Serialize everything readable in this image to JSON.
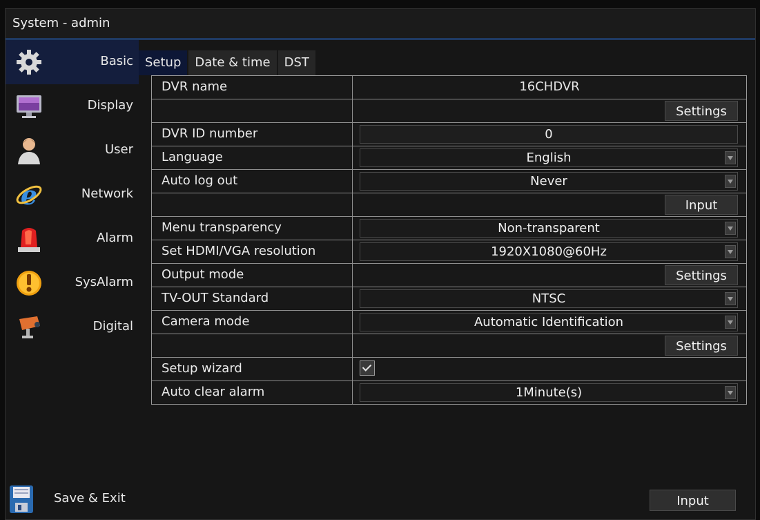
{
  "window": {
    "title": "System - admin"
  },
  "sidebar": {
    "items": [
      {
        "label": "Basic",
        "icon": "gear-icon",
        "active": true
      },
      {
        "label": "Display",
        "icon": "monitor-icon"
      },
      {
        "label": "User",
        "icon": "user-icon"
      },
      {
        "label": "Network",
        "icon": "network-icon"
      },
      {
        "label": "Alarm",
        "icon": "alarm-light-icon"
      },
      {
        "label": "SysAlarm",
        "icon": "warning-icon"
      },
      {
        "label": "Digital",
        "icon": "camera-icon"
      }
    ],
    "save_exit": {
      "label": "Save & Exit",
      "icon": "floppy-disk-icon"
    }
  },
  "tabs": [
    {
      "label": "Setup",
      "active": true
    },
    {
      "label": "Date & time"
    },
    {
      "label": "DST"
    }
  ],
  "settings": {
    "dvr_name": {
      "label": "DVR name",
      "value": "16CHDVR"
    },
    "dvr_name_settings": {
      "button": "Settings"
    },
    "dvr_id": {
      "label": "DVR ID number",
      "value": "0"
    },
    "language": {
      "label": "Language",
      "value": "English"
    },
    "auto_logout": {
      "label": "Auto log out",
      "value": "Never"
    },
    "auto_logout_input": {
      "button": "Input"
    },
    "menu_transparency": {
      "label": "Menu transparency",
      "value": "Non-transparent"
    },
    "resolution": {
      "label": "Set HDMI/VGA resolution",
      "value": "1920X1080@60Hz"
    },
    "output_mode": {
      "label": "Output mode",
      "button": "Settings"
    },
    "tv_out": {
      "label": "TV-OUT Standard",
      "value": "NTSC"
    },
    "camera_mode": {
      "label": "Camera mode",
      "value": "Automatic Identification"
    },
    "camera_mode_settings": {
      "button": "Settings"
    },
    "setup_wizard": {
      "label": "Setup wizard",
      "checked": true
    },
    "auto_clear_alarm": {
      "label": "Auto clear alarm",
      "value": "1Minute(s)"
    }
  },
  "bottom": {
    "input_button": "Input"
  },
  "colors": {
    "accent": "#1f3a63",
    "active_nav": "#141e3d",
    "active_tab": "#0d1736"
  }
}
